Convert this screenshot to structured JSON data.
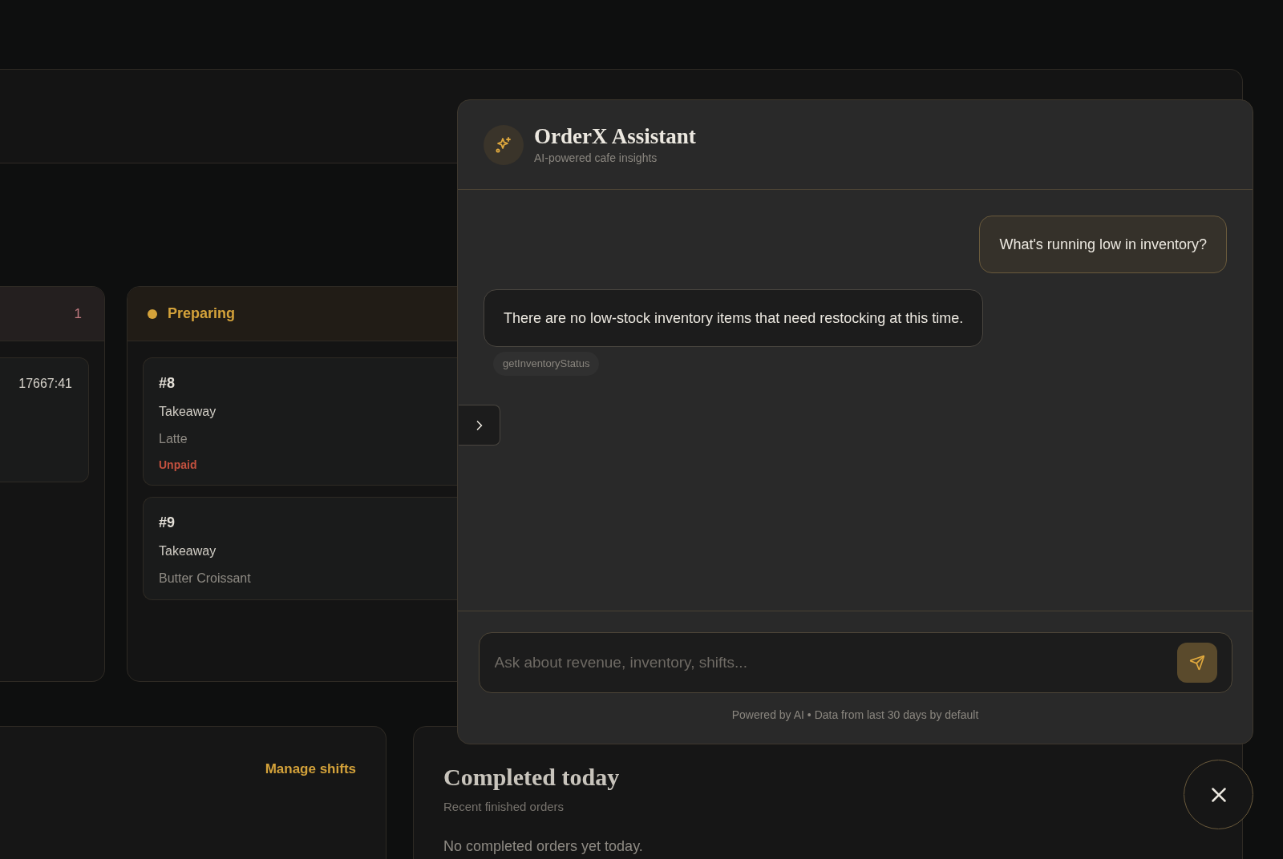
{
  "board": {
    "columns": [
      {
        "count": "1",
        "color": "#c27a80",
        "orders": [
          {
            "time": "17667:41"
          }
        ]
      },
      {
        "title": "Preparing",
        "color": "#d4a23a",
        "orders": [
          {
            "number": "#8",
            "type": "Takeaway",
            "items": "Latte",
            "payment": "Unpaid"
          },
          {
            "number": "#9",
            "type": "Takeaway",
            "items": "Butter Croissant"
          }
        ]
      }
    ]
  },
  "shifts_card": {
    "link": "Manage shifts"
  },
  "completed_card": {
    "title": "Completed today",
    "subtitle": "Recent finished orders",
    "empty": "No completed orders yet today."
  },
  "assistant": {
    "title": "OrderX Assistant",
    "subtitle": "AI-powered cafe insights",
    "messages": [
      {
        "kind": "user",
        "text": "What's running low in inventory?"
      },
      {
        "kind": "assistant",
        "text": "There are no low-stock inventory items that need restocking at this time.",
        "tools": [
          "getInventoryStatus"
        ]
      }
    ],
    "input": {
      "placeholder": "Ask about revenue, inventory, shifts..."
    },
    "footer": "Powered by AI • Data from last 30 days by default"
  }
}
